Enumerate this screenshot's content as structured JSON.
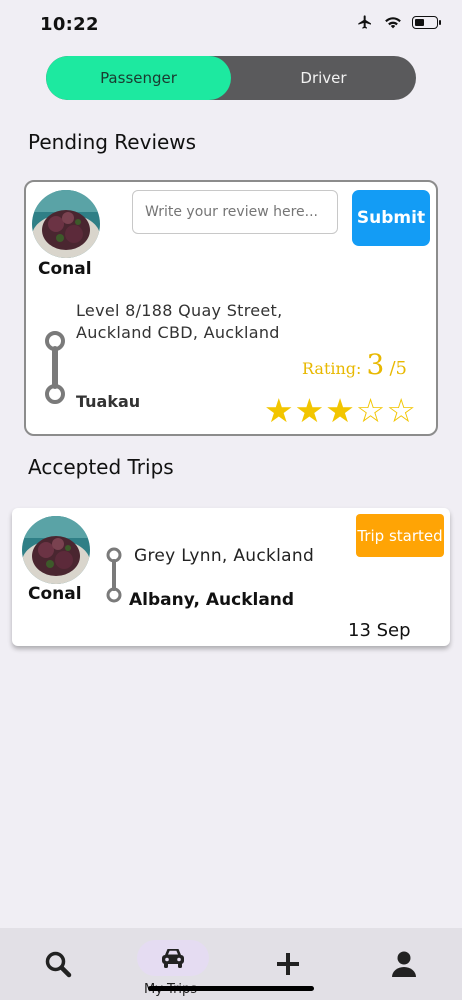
{
  "status_bar": {
    "time": "10:22",
    "battery_level": 0.35
  },
  "toggle": {
    "passenger_label": "Passenger",
    "driver_label": "Driver",
    "selected": "Passenger"
  },
  "pending_reviews": {
    "title": "Pending Reviews",
    "card": {
      "name": "Conal",
      "review_placeholder": "Write your review here...",
      "submit_label": "Submit",
      "from": "Level 8/188 Quay Street, Auckland CBD, Auckland",
      "to": "Tuakau",
      "rating_label": "Rating:",
      "rating_value": "3",
      "rating_max": "/5",
      "stars_filled": 3,
      "stars_total": 5
    }
  },
  "accepted_trips": {
    "title": "Accepted Trips",
    "card": {
      "name": "Conal",
      "from": "Grey Lynn, Auckland",
      "to": "Albany, Auckland",
      "status": "Trip started",
      "date": "13 Sep"
    }
  },
  "bottom_nav": {
    "items": [
      {
        "icon": "search-icon"
      },
      {
        "icon": "car-icon",
        "label": "My Trips",
        "active": true
      },
      {
        "icon": "plus-icon"
      },
      {
        "icon": "person-icon"
      }
    ]
  },
  "colors": {
    "accent_green": "#1de9a0",
    "submit_blue": "#139cf5",
    "badge_orange": "#ffa405",
    "star_gold": "#f2c500",
    "background": "#f0eef4"
  }
}
